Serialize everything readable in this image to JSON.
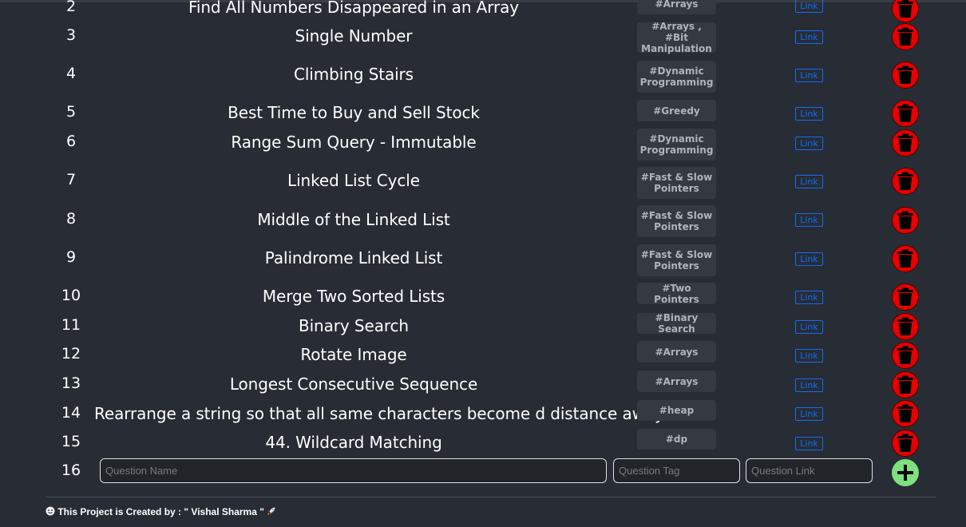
{
  "rows": [
    {
      "num": "2",
      "name": "Find All Numbers Disappeared in an Array",
      "tag": "#Arrays",
      "link": "Link"
    },
    {
      "num": "3",
      "name": "Single Number",
      "tag": "#Arrays , #Bit\nManipulation",
      "link": "Link"
    },
    {
      "num": "4",
      "name": "Climbing Stairs",
      "tag": "#Dynamic\nProgramming",
      "link": "Link"
    },
    {
      "num": "5",
      "name": "Best Time to Buy and Sell Stock",
      "tag": "#Greedy",
      "link": "Link"
    },
    {
      "num": "6",
      "name": "Range Sum Query - Immutable",
      "tag": "#Dynamic\nProgramming",
      "link": "Link"
    },
    {
      "num": "7",
      "name": "Linked List Cycle",
      "tag": "#Fast & Slow\nPointers",
      "link": "Link"
    },
    {
      "num": "8",
      "name": "Middle of the Linked List",
      "tag": "#Fast & Slow\nPointers",
      "link": "Link"
    },
    {
      "num": "9",
      "name": "Palindrome Linked List",
      "tag": "#Fast & Slow\nPointers",
      "link": "Link"
    },
    {
      "num": "10",
      "name": "Merge Two Sorted Lists",
      "tag": "#Two Pointers",
      "link": "Link"
    },
    {
      "num": "11",
      "name": "Binary Search",
      "tag": "#Binary Search",
      "link": "Link"
    },
    {
      "num": "12",
      "name": "Rotate Image",
      "tag": "#Arrays",
      "link": "Link"
    },
    {
      "num": "13",
      "name": "Longest Consecutive Sequence",
      "tag": "#Arrays",
      "link": "Link"
    },
    {
      "num": "14",
      "name": "Rearrange a string so that all same characters become d distance away",
      "tag": "#heap",
      "link": "Link"
    },
    {
      "num": "15",
      "name": "44. Wildcard Matching",
      "tag": "#dp",
      "link": "Link"
    }
  ],
  "new_row": {
    "num": "16",
    "name_placeholder": "Question Name",
    "tag_placeholder": "Question Tag",
    "link_placeholder": "Question Link"
  },
  "footer": {
    "text": "This Project is Created by : \" Vishal Sharma \""
  },
  "colors": {
    "background": "#282c34",
    "delete_button": "#e60000",
    "add_button": "#7ee07e",
    "link": "#0d6efd"
  }
}
